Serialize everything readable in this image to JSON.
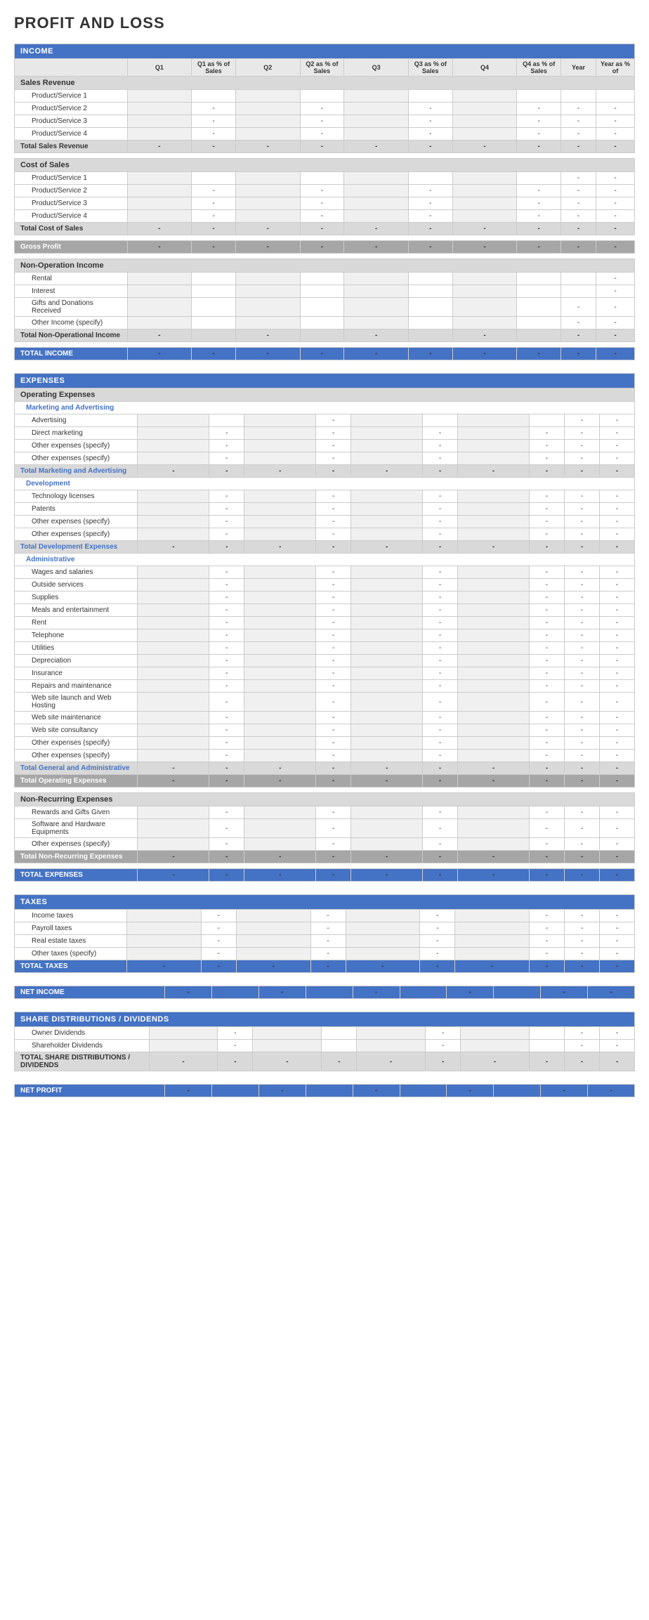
{
  "title": "PROFIT AND LOSS",
  "columns": {
    "headers": [
      "",
      "Q1",
      "Q1 as % of Sales",
      "Q2",
      "Q2 as % of Sales",
      "Q3",
      "Q3 as % of Sales",
      "Q4",
      "Q4 as % of Sales",
      "Year",
      "Year as % of"
    ]
  },
  "income": {
    "label": "INCOME",
    "sales_revenue": {
      "label": "Sales Revenue",
      "items": [
        "Product/Service 1",
        "Product/Service 2",
        "Product/Service 3",
        "Product/Service 4"
      ],
      "total_label": "Total Sales Revenue"
    },
    "cost_of_sales": {
      "label": "Cost of Sales",
      "items": [
        "Product/Service 1",
        "Product/Service 2",
        "Product/Service 3",
        "Product/Service 4"
      ],
      "total_label": "Total Cost of Sales"
    },
    "gross_profit": "Gross Profit",
    "non_operation": {
      "label": "Non-Operation Income",
      "items": [
        "Rental",
        "Interest",
        "Gifts and Donations Received",
        "Other Income (specify)"
      ],
      "total_label": "Total Non-Operational Income"
    },
    "total_label": "TOTAL INCOME"
  },
  "expenses": {
    "label": "EXPENSES",
    "operating": {
      "label": "Operating Expenses",
      "marketing": {
        "label": "Marketing and Advertising",
        "items": [
          "Advertising",
          "Direct marketing",
          "Other expenses (specify)",
          "Other expenses (specify)"
        ],
        "total_label": "Total Marketing and Advertising"
      },
      "development": {
        "label": "Development",
        "items": [
          "Technology licenses",
          "Patents",
          "Other expenses (specify)",
          "Other expenses (specify)"
        ],
        "total_label": "Total Development Expenses"
      },
      "administrative": {
        "label": "Administrative",
        "items": [
          "Wages and salaries",
          "Outside services",
          "Supplies",
          "Meals and entertainment",
          "Rent",
          "Telephone",
          "Utilities",
          "Depreciation",
          "Insurance",
          "Repairs and maintenance",
          "Web site launch and Web Hosting",
          "Web site maintenance",
          "Web site consultancy",
          "Other expenses (specify)",
          "Other expenses (specify)"
        ],
        "total_label": "Total General and Administrative"
      },
      "total_label": "Total Operating Expenses"
    },
    "non_recurring": {
      "label": "Non-Recurring Expenses",
      "items": [
        "Rewards and Gifts Given",
        "Software and Hardware Equipments",
        "Other expenses (specify)"
      ],
      "total_label": "Total Non-Recurring Expenses"
    },
    "total_label": "TOTAL EXPENSES"
  },
  "taxes": {
    "label": "TAXES",
    "items": [
      "Income taxes",
      "Payroll taxes",
      "Real estate taxes",
      "Other taxes (specify)"
    ],
    "total_label": "TOTAL TAXES"
  },
  "net_income": "NET INCOME",
  "share_distributions": {
    "label": "SHARE DISTRIBUTIONS / DIVIDENDS",
    "items": [
      "Owner Dividends",
      "Shareholder Dividends"
    ],
    "total_label": "TOTAL SHARE DISTRIBUTIONS / DIVIDENDS"
  },
  "net_profit": "NET PROFIT",
  "dash": "-"
}
